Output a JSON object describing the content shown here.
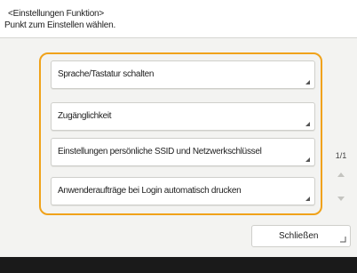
{
  "header": {
    "title": "<Einstellungen Funktion>",
    "instruction": "Punkt zum Einstellen wählen."
  },
  "options": [
    {
      "label": "Sprache/Tastatur schalten"
    },
    {
      "label": "Zugänglichkeit"
    },
    {
      "label": "Einstellungen persönliche SSID und Netzwerkschlüssel"
    },
    {
      "label": "Anwenderaufträge bei Login automatisch drucken"
    }
  ],
  "pager": {
    "text": "1/1"
  },
  "close_button": {
    "label": "Schließen"
  },
  "colors": {
    "highlight": "#f0a21a",
    "footer": "#1a1a1a"
  }
}
